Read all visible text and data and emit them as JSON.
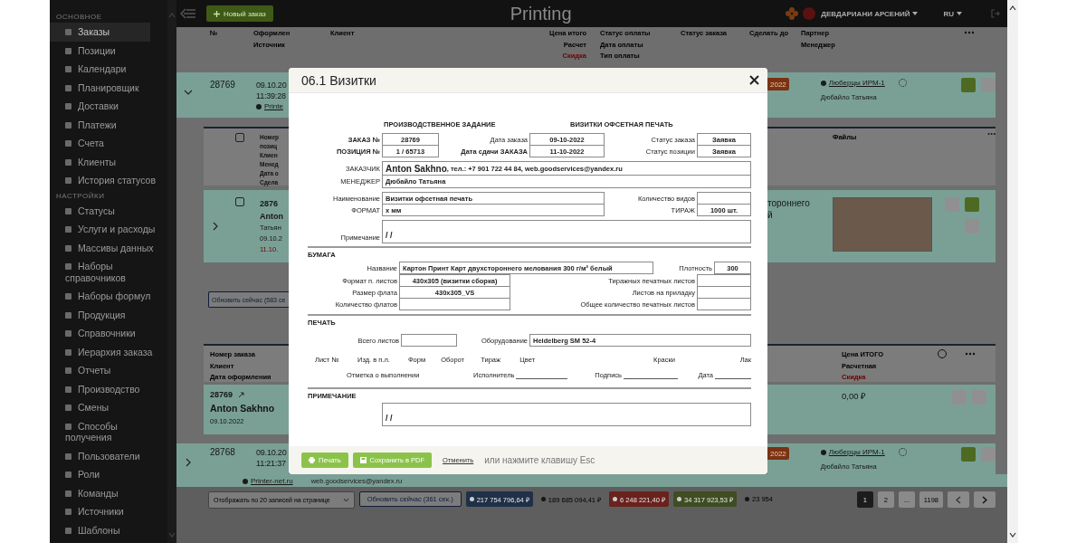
{
  "topbar": {
    "new_order_button": "Новый заказ",
    "title": "Printing",
    "user": "ДЕВДАРИАНИ АРСЕНИЙ",
    "language": "RU"
  },
  "sidebar": {
    "sections": [
      {
        "title": "ОСНОВНОЕ",
        "items": [
          {
            "label": "Заказы",
            "selected": true
          },
          {
            "label": "Позиции",
            "selected": false
          },
          {
            "label": "Календари",
            "selected": false
          },
          {
            "label": "Планировщик",
            "selected": false
          },
          {
            "label": "Доставки",
            "selected": false
          },
          {
            "label": "Платежи",
            "selected": false
          },
          {
            "label": "Счета",
            "selected": false
          },
          {
            "label": "Клиенты",
            "selected": false
          },
          {
            "label": "История статусов",
            "selected": false
          }
        ]
      },
      {
        "title": "НАСТРОЙКИ",
        "items": [
          {
            "label": "Статусы",
            "selected": false
          },
          {
            "label": "Услуги и расходы",
            "selected": false
          },
          {
            "label": "Массивы данных",
            "selected": false
          },
          {
            "label": "Наборы справочников",
            "selected": false
          },
          {
            "label": "Наборы формул",
            "selected": false
          },
          {
            "label": "Продукция",
            "selected": false
          },
          {
            "label": "Справочники",
            "selected": false
          },
          {
            "label": "Иерархия заказа",
            "selected": false
          },
          {
            "label": "Отчеты",
            "selected": false
          },
          {
            "label": "Производство",
            "selected": false
          },
          {
            "label": "Смены",
            "selected": false
          },
          {
            "label": "Способы получения",
            "selected": false
          },
          {
            "label": "Пользователи",
            "selected": false
          },
          {
            "label": "Роли",
            "selected": false
          },
          {
            "label": "Команды",
            "selected": false
          },
          {
            "label": "Источники",
            "selected": false
          },
          {
            "label": "Шаблоны",
            "selected": false
          }
        ]
      }
    ]
  },
  "table_header": {
    "columns": [
      {
        "lines": [
          "№"
        ]
      },
      {
        "lines": [
          "Оформлен",
          "Источник"
        ]
      },
      {
        "lines": [
          "Клиент"
        ]
      },
      {
        "lines": [
          "Цена итого",
          "Расчет"
        ],
        "alert": "Скидка"
      },
      {
        "lines": [
          "Статус оплаты",
          "Дата оплаты",
          "Тип оплаты"
        ]
      },
      {
        "lines": [
          "Статус заказа"
        ]
      },
      {
        "lines": [
          "Сделать до"
        ]
      },
      {
        "lines": [
          "Партнер",
          "Менеджер"
        ]
      }
    ]
  },
  "left_strip": {
    "order_row": {
      "expanded": true,
      "number": "28769",
      "date": "09.10.20",
      "time": "11:39:28",
      "source": "Printe"
    },
    "positions_header": {
      "checked": false,
      "lines": [
        "Номер",
        "позиц",
        "Клиен",
        "Менед",
        "Дата о",
        "Сдела"
      ]
    },
    "position_row": {
      "checked": false,
      "expanded": false,
      "number": "2876",
      "client": "Anton",
      "manager": "Татьян",
      "date": "09.10.2",
      "due": "11.10."
    },
    "refresh_button": "Обновить сейчас (583 се",
    "summary_header": [
      "Номер заказа",
      "Клиент",
      "Дата оформления"
    ],
    "summary_row": {
      "number": "28769",
      "client": "Anton Sakhno",
      "date": "09.10.2022"
    },
    "next_row": {
      "expanded": false,
      "number": "28768",
      "date": "09.10.20",
      "time": "11:21:37"
    }
  },
  "right_strip": {
    "order_row": {
      "badge": "2022",
      "partner": "Люберцы ИРМ-1",
      "manager": "Дюбайло Татьяна"
    },
    "files_header": "Файлы",
    "position_row": {
      "lines": [
        "тороннего",
        "й"
      ]
    },
    "summary_header": {
      "lines": [
        "Цена ИТОГО",
        "Расчетная"
      ],
      "alert": "Скидка"
    },
    "summary_row": {
      "price": "0,00 ₽"
    },
    "next_row": {
      "badge": "2022",
      "partner": "Люберцы ИРМ-1",
      "manager": "Дюбайло Татьяна"
    }
  },
  "next_row_sources": {
    "source": "Printer-net.ru",
    "email": "web.goodservices@yandex.ru"
  },
  "modal": {
    "title": "06.1 Визитки",
    "form": {
      "title_left": "ПРОИЗВОДСТВЕННОЕ ЗАДАНИЕ",
      "title_right": "ВИЗИТКИ ОФСЕТНАЯ ПЕЧАТЬ",
      "order_rows": [
        [
          {
            "label": "ЗАКАЗ №",
            "strong": true,
            "value": "28769"
          },
          {
            "label": "Дата заказа",
            "strong": false,
            "value": "09-10-2022"
          },
          {
            "label": "Статус заказа",
            "strong": false,
            "value": "Заявка"
          }
        ],
        [
          {
            "label": "ПОЗИЦИЯ №",
            "strong": true,
            "value": "1 / 65713"
          },
          {
            "label": "Дата сдачи ЗАКАЗА",
            "strong": true,
            "value": "11-10-2022"
          },
          {
            "label": "Статус позиции",
            "strong": false,
            "value": "Заявка"
          }
        ]
      ],
      "customer": {
        "label": "ЗАКАЗЧИК",
        "name": "Anton Sakhno",
        "contacts": ", тел.: +7 901 722 44 84, web.goodservices@yandex.ru"
      },
      "manager": {
        "label": "МЕНЕДЖЕР",
        "value": "Дюбайло Татьяна"
      },
      "product_rows": [
        {
          "label": "Наименование",
          "value": "Визитки офсетная печать",
          "side_label": "Количество видов"
        },
        {
          "label": "ФОРМАТ",
          "value": "х мм",
          "side_label": "ТИРАЖ",
          "side_value": "1000 шт."
        }
      ],
      "note": {
        "label": "Примечание",
        "value": "/ /"
      },
      "paper": {
        "heading": "БУМАГА",
        "name_label": "Название",
        "name": "Картон Принт Карт двухстороннего мелования 300 г/м² белый",
        "density_label": "Плотность",
        "density": "300",
        "rows": [
          {
            "label": "Формат п. листов",
            "value": "430x305 (визитки сборка)",
            "side_label": "Тиражных печатных листов"
          },
          {
            "label": "Размер флата",
            "value": "430x305_VS",
            "side_label": "Листов на приладку"
          },
          {
            "label": "Количество флатов",
            "side_label": "Общее количество печатных листов"
          }
        ]
      },
      "print": {
        "heading": "ПЕЧАТЬ",
        "sheets_label": "Всего листов",
        "equipment_label": "Оборудование",
        "equipment": "Heidelberg SM 52-4",
        "columns": [
          "Лист №",
          "Изд. в п.л.",
          "Форм",
          "Оборот",
          "Тираж",
          "Цвет",
          "Краски",
          "Лак"
        ],
        "signoff": [
          {
            "label": "Отметка о выполнении",
            "kind": "text"
          },
          {
            "label": "Исполнитель",
            "kind": "line"
          },
          {
            "label": "Подпись",
            "kind": "line"
          },
          {
            "label": "Дата",
            "kind": "line"
          }
        ]
      },
      "remark": {
        "heading": "ПРИМЕЧАНИЕ",
        "value": "/ /"
      }
    },
    "buttons": [
      {
        "label": "Печать",
        "kind": "print"
      },
      {
        "label": "Сохранить в PDF",
        "kind": "pdf"
      }
    ],
    "cancel_link": "Отменить",
    "hint": "или нажмите клавишу Esc"
  },
  "footer": {
    "page_size": "Отображать по 20 записей на странице",
    "refresh_button": "Обновить сейчас (361 сек.)",
    "stats": [
      {
        "value": "217 754 796,64 ₽",
        "kind": "badge",
        "color": "#1f3048"
      },
      {
        "value": "189 685 094,41 ₽",
        "kind": "plain"
      },
      {
        "value": "6 248 221,40 ₽",
        "kind": "badge",
        "color": "#6a221c"
      },
      {
        "value": "34 317 923,53 ₽",
        "kind": "badge",
        "color": "#3f4d22"
      },
      {
        "value": "23 954",
        "kind": "plain"
      }
    ],
    "pages": [
      {
        "label": "1",
        "selected": true
      },
      {
        "label": "2",
        "selected": false
      },
      {
        "label": "...",
        "selected": false
      },
      {
        "label": "1198",
        "selected": false
      }
    ]
  }
}
